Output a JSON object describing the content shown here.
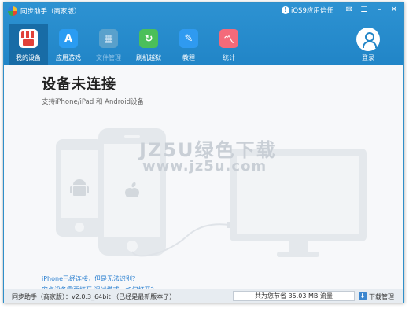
{
  "window": {
    "title": "同步助手（商家版）",
    "ios_trust": "iOS9应用信任",
    "ios_trust_icon": "info-icon"
  },
  "nav": {
    "items": [
      {
        "label": "我的设备",
        "icon": "store-icon",
        "active": true
      },
      {
        "label": "应用游戏",
        "icon": "app-store-icon",
        "active": false
      },
      {
        "label": "文件管理",
        "icon": "folder-icon",
        "active": false,
        "disabled": true
      },
      {
        "label": "刷机越狱",
        "icon": "refresh-icon",
        "active": false
      },
      {
        "label": "教程",
        "icon": "feather-icon",
        "active": false
      },
      {
        "label": "统计",
        "icon": "chart-icon",
        "active": false
      }
    ],
    "login_label": "登录"
  },
  "main": {
    "title": "设备未连接",
    "subtitle": "支持iPhone/iPad 和 Android设备",
    "link_1": "iPhone已经连接，但是无法识别？",
    "link_2": "安卓设备需要打开 调试模式，如何打开？"
  },
  "watermark": {
    "line1": "JZ5U绿色下载",
    "line2": "www.jz5u.com"
  },
  "status": {
    "version_text": "同步助手（商家版）：v2.0.3_64bit （已经是最新版本了）",
    "traffic_text": "共为您节省  35.03 MB 流量",
    "download_label": "下载管理"
  },
  "colors": {
    "header": "#2185c7",
    "active_tab": "#186ca6",
    "link": "#2a7fd0",
    "device_gray": "#e4e8ec"
  }
}
